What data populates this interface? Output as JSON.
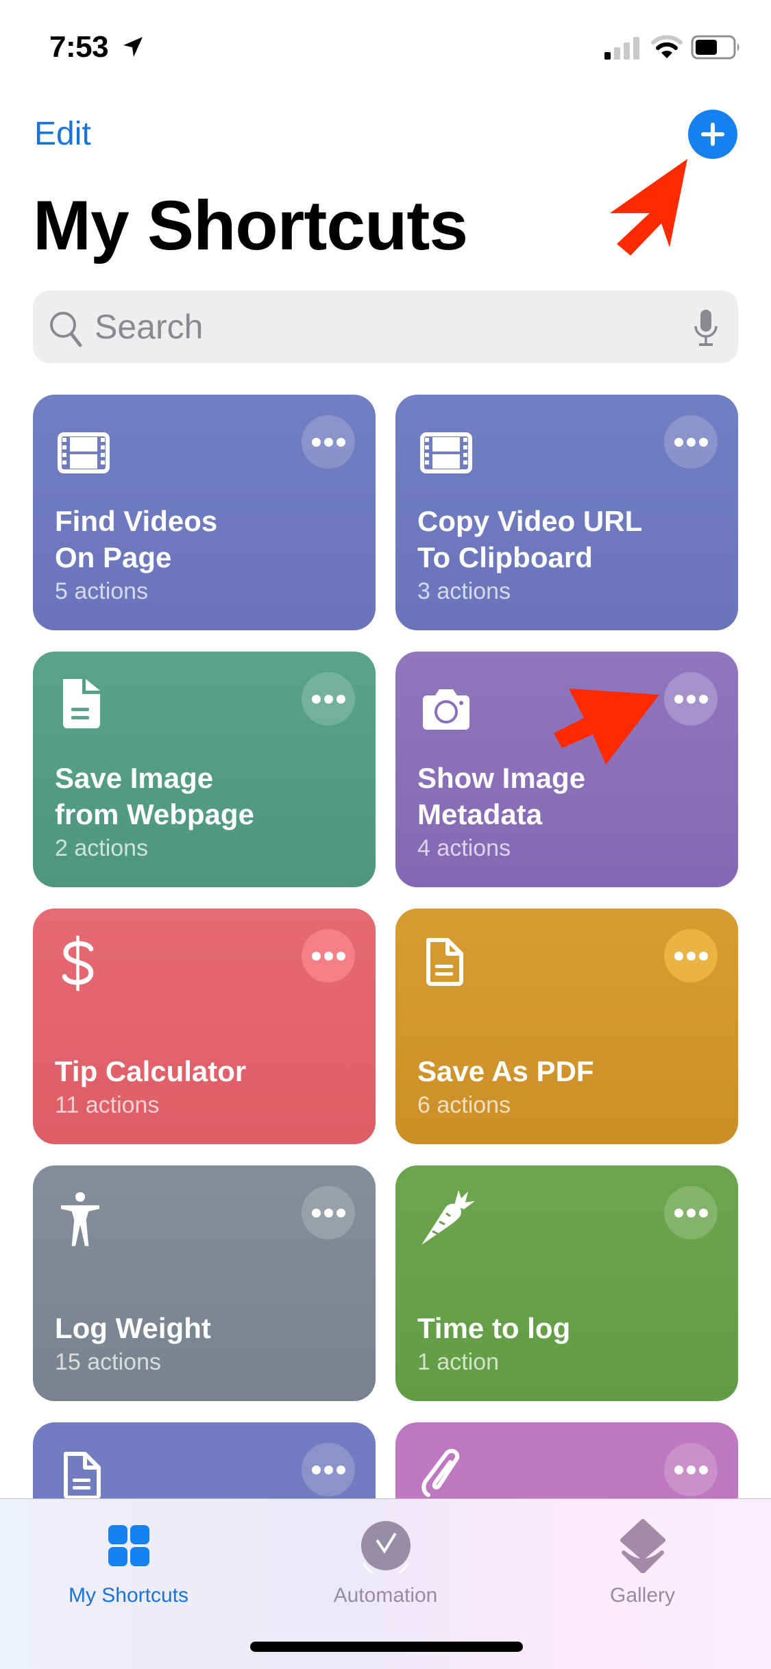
{
  "status_bar": {
    "time": "7:53",
    "location_icon": "location-arrow-icon",
    "signal_bars_active": 1,
    "signal_bars_total": 4,
    "wifi_arcs_active": 2,
    "wifi_arcs_total": 3,
    "battery_percent": 55
  },
  "header": {
    "edit_label": "Edit",
    "add_icon": "plus-icon",
    "title": "My Shortcuts"
  },
  "search": {
    "placeholder": "Search",
    "value": "",
    "search_icon": "magnifier-icon",
    "mic_icon": "microphone-icon"
  },
  "shortcuts": [
    {
      "title": "Find Videos\nOn Page",
      "line1": "Find Videos",
      "line2": "On Page",
      "subtitle": "5 actions",
      "icon": "film-icon",
      "color": "#6f7bc0"
    },
    {
      "title": "Copy Video URL\nTo Clipboard",
      "line1": "Copy Video URL",
      "line2": "To Clipboard",
      "subtitle": "3 actions",
      "icon": "film-icon",
      "color": "#6f7bc0"
    },
    {
      "title": "Save Image\nfrom Webpage",
      "line1": "Save Image",
      "line2": "from Webpage",
      "subtitle": "2 actions",
      "icon": "document-filled-icon",
      "color": "#519c82"
    },
    {
      "title": "Show Image\nMetadata",
      "line1": "Show Image",
      "line2": "Metadata",
      "subtitle": "4 actions",
      "icon": "camera-icon",
      "color": "#8c70ba"
    },
    {
      "title": "Tip Calculator",
      "line1": "",
      "line2": "Tip Calculator",
      "subtitle": "11 actions",
      "icon": "dollar-icon",
      "color": "#e2606a"
    },
    {
      "title": "Save As PDF",
      "line1": "",
      "line2": "Save As PDF",
      "subtitle": "6 actions",
      "icon": "document-outline-icon",
      "color": "#d4982d"
    },
    {
      "title": "Log Weight",
      "line1": "",
      "line2": "Log Weight",
      "subtitle": "15 actions",
      "icon": "person-icon",
      "color": "#7f8a96"
    },
    {
      "title": "Time to log",
      "line1": "",
      "line2": "Time to log",
      "subtitle": "1 action",
      "icon": "carrot-icon",
      "color": "#66a24b"
    },
    {
      "title": "",
      "line1": "",
      "line2": "",
      "subtitle": "",
      "icon": "document-outline-icon",
      "color": "#6f7bc0"
    },
    {
      "title": "",
      "line1": "",
      "line2": "",
      "subtitle": "",
      "icon": "paperclip-icon",
      "color": "#bd78be"
    }
  ],
  "tabs": [
    {
      "label": "My Shortcuts",
      "icon": "grid-icon",
      "active": true
    },
    {
      "label": "Automation",
      "icon": "automation-check-icon",
      "active": false
    },
    {
      "label": "Gallery",
      "icon": "layers-icon",
      "active": false
    }
  ],
  "colors": {
    "accent": "#1681ef",
    "tab_active": "#1a73d9",
    "tab_inactive": "#958ca3",
    "annotation": "#ff2a00"
  },
  "annotations": [
    {
      "type": "arrow",
      "points_to": "add-shortcut-button"
    },
    {
      "type": "arrow",
      "points_to": "show-image-metadata-more-button"
    }
  ]
}
